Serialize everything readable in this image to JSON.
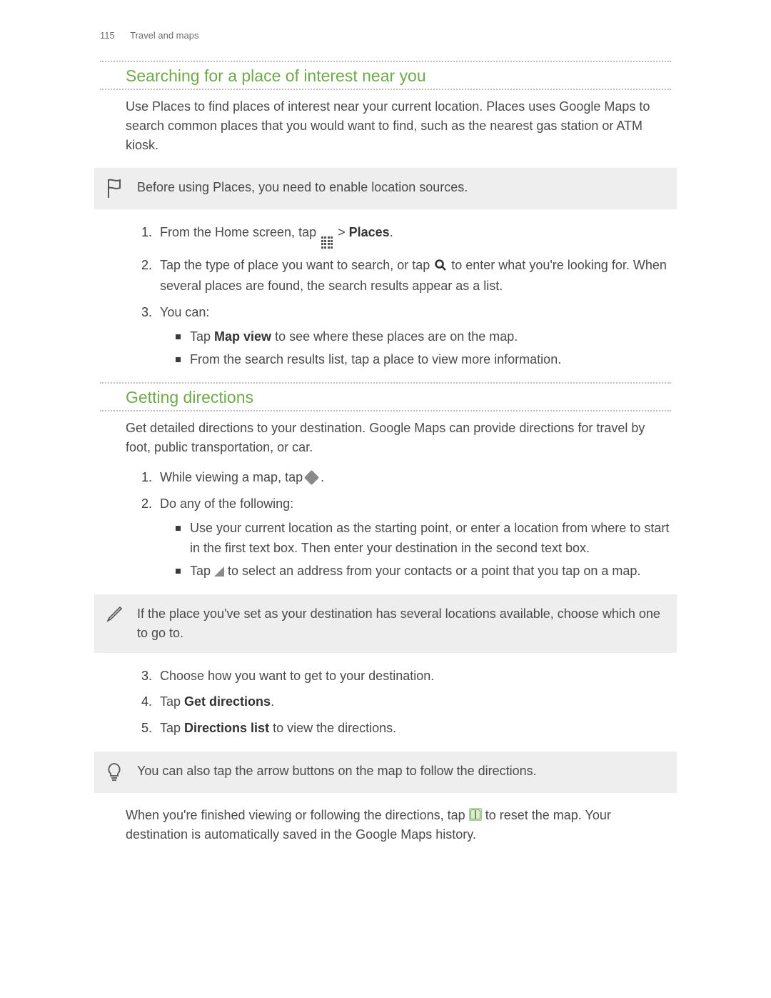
{
  "header": {
    "page_number": "115",
    "chapter": "Travel and maps"
  },
  "section1": {
    "title": "Searching for a place of interest near you",
    "intro": "Use Places to find places of interest near your current location. Places uses Google Maps to search common places that you would want to find, such as the nearest gas station or ATM kiosk.",
    "callout": "Before using Places, you need to enable location sources.",
    "step1_pre": "From the Home screen, tap ",
    "step1_post": " > ",
    "step1_bold": "Places",
    "step1_end": ".",
    "step2_pre": "Tap the type of place you want to search, or tap ",
    "step2_post": " to enter what you're looking for. When several places are found, the search results appear as a list.",
    "step3_lead": "You can:",
    "step3_a_pre": "Tap ",
    "step3_a_bold": "Map view",
    "step3_a_post": " to see where these places are on the map.",
    "step3_b": "From the search results list, tap a place to view more information."
  },
  "section2": {
    "title": "Getting directions",
    "intro": "Get detailed directions to your destination. Google Maps can provide directions for travel by foot, public transportation, or car.",
    "step1_pre": "While viewing a map, tap ",
    "step1_post": ".",
    "step2_lead": "Do any of the following:",
    "step2_a": "Use your current location as the starting point, or enter a location from where to start in the first text box. Then enter your destination in the second text box.",
    "step2_b_pre": "Tap ",
    "step2_b_post": " to select an address from your contacts or a point that you tap on a map.",
    "callout_choose": "If the place you've set as your destination has several locations available, choose which one to go to.",
    "step3": "Choose how you want to get to your destination.",
    "step4_pre": "Tap ",
    "step4_bold": "Get directions",
    "step4_post": ".",
    "step5_pre": "Tap ",
    "step5_bold": "Directions list",
    "step5_post": " to view the directions.",
    "callout_tip": "You can also tap the arrow buttons on the map to follow the directions.",
    "closing_pre": "When you're finished viewing or following the directions, tap ",
    "closing_post": " to reset the map. Your destination is automatically saved in the Google Maps history."
  }
}
